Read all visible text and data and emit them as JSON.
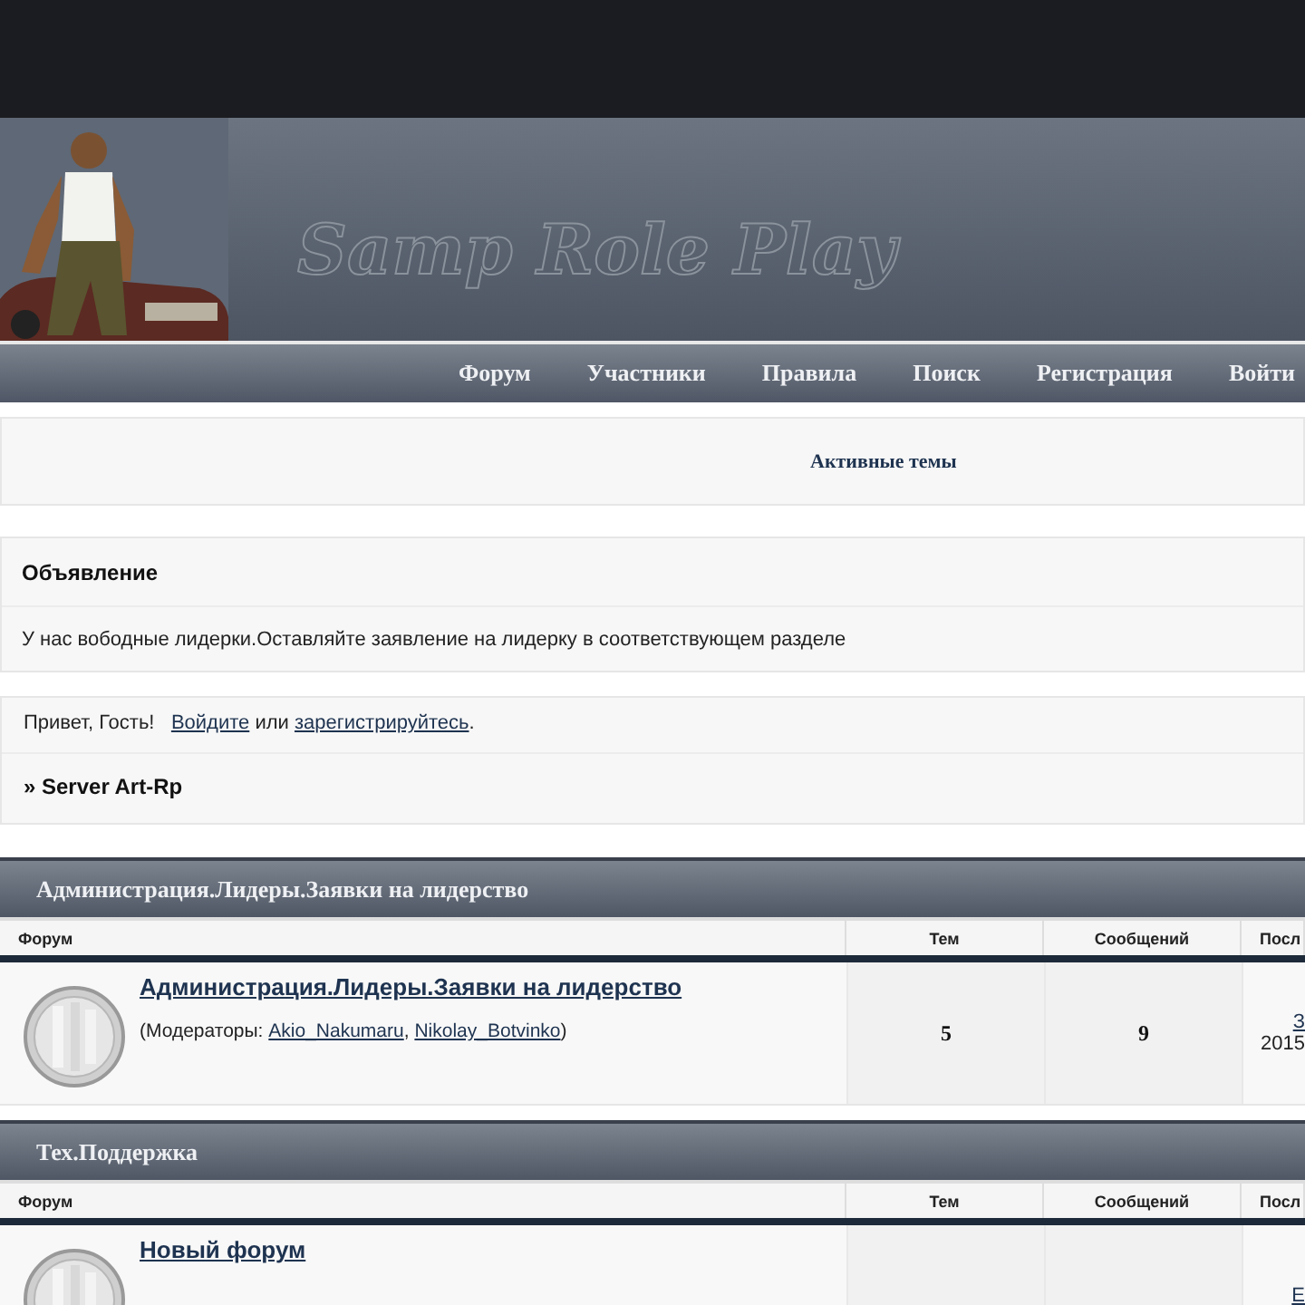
{
  "logo": {
    "text": "Samp Role Play"
  },
  "nav": [
    "Форум",
    "Участники",
    "Правила",
    "Поиск",
    "Регистрация",
    "Войти"
  ],
  "active_topics": {
    "label": "Активные темы"
  },
  "announcement": {
    "title": "Объявление",
    "text": "У нас вободные лидерки.Оставляйте заявление на лидерку в соответствующем разделе"
  },
  "welcome": {
    "greeting": "Привет, Гость!",
    "login_link": "Войдите",
    "middle": "или",
    "register_link": "зарегистрируйтесь",
    "end": ".",
    "server": "» Server Art-Rp"
  },
  "categories": [
    {
      "title": "Администрация.Лидеры.Заявки на лидерство",
      "columns": [
        "Форум",
        "Тем",
        "Сообщений",
        "Посл"
      ],
      "forums": [
        {
          "name": "Администрация.Лидеры.Заявки на лидерство",
          "moderators_label": "(Модераторы:",
          "moderators": [
            "Akio_Nakumaru",
            "Nikolay_Botvinko"
          ],
          "separator": ",",
          "close": ")",
          "topics": "5",
          "posts": "9",
          "last_post": [
            "З",
            "2015"
          ]
        }
      ]
    },
    {
      "title": "Тех.Поддержка",
      "columns": [
        "Форум",
        "Тем",
        "Сообщений",
        "Посл"
      ],
      "forums": [
        {
          "name": "Новый форум",
          "last_post": [
            "Е"
          ]
        }
      ]
    }
  ]
}
